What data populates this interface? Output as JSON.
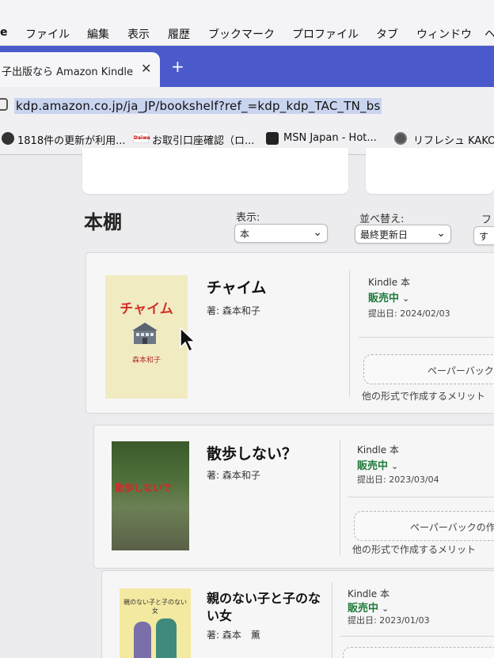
{
  "menubar": {
    "app": "e",
    "items": [
      "ファイル",
      "編集",
      "表示",
      "履歴",
      "ブックマーク",
      "プロファイル",
      "タブ",
      "ウィンドウ",
      "ヘ"
    ]
  },
  "tab": {
    "title": "子出版なら Amazon Kindle ダ",
    "close": "✕",
    "new_tab": "+"
  },
  "address": {
    "url": "kdp.amazon.co.jp/ja_JP/bookshelf?ref_=kdp_kdp_TAC_TN_bs"
  },
  "bookmarks": [
    {
      "icon": "globe-icon",
      "label": "1818件の更新が利用..."
    },
    {
      "icon": "daiwa-icon",
      "icon_text": "Daiwa",
      "label": "お取引口座確認（ロ..."
    },
    {
      "icon": "msn-icon",
      "label": "MSN Japan - Hot..."
    },
    {
      "icon": "wordpress-icon",
      "label": "リフレシュ KAKO "
    }
  ],
  "bookshelf": {
    "title": "本棚",
    "view_label": "表示:",
    "view_value": "本",
    "sort_label": "並べ替え:",
    "sort_value": "最終更新日",
    "filter_label": "フ",
    "filter_value": "す"
  },
  "books": [
    {
      "title": "チャイム",
      "author": "著: 森本和子",
      "cover_title": "チャイム",
      "cover_author": "森本和子",
      "format": "Kindle 本",
      "status": "販売中",
      "pubdate": "提出日: 2024/02/03",
      "paperback": "ペーパーバック",
      "other": "他の形式で作成するメリット"
    },
    {
      "title": "散歩しない？",
      "author": "著: 森本和子",
      "cover_title": "散歩しないで",
      "format": "Kindle 本",
      "status": "販売中",
      "pubdate": "提出日: 2023/03/04",
      "paperback": "ペーパーバックの作",
      "other": "他の形式で作成するメリット"
    },
    {
      "title": "親のない子と子のない女",
      "author": "著: 森本　薫",
      "cover_title": "親のない子と子のない女",
      "format": "Kindle 本",
      "status": "販売中",
      "pubdate": "提出日: 2023/01/03"
    }
  ],
  "colors": {
    "tab_strip": "#4a5acb",
    "status_green": "#1f7a3a",
    "cover_title_red": "#d23228"
  }
}
